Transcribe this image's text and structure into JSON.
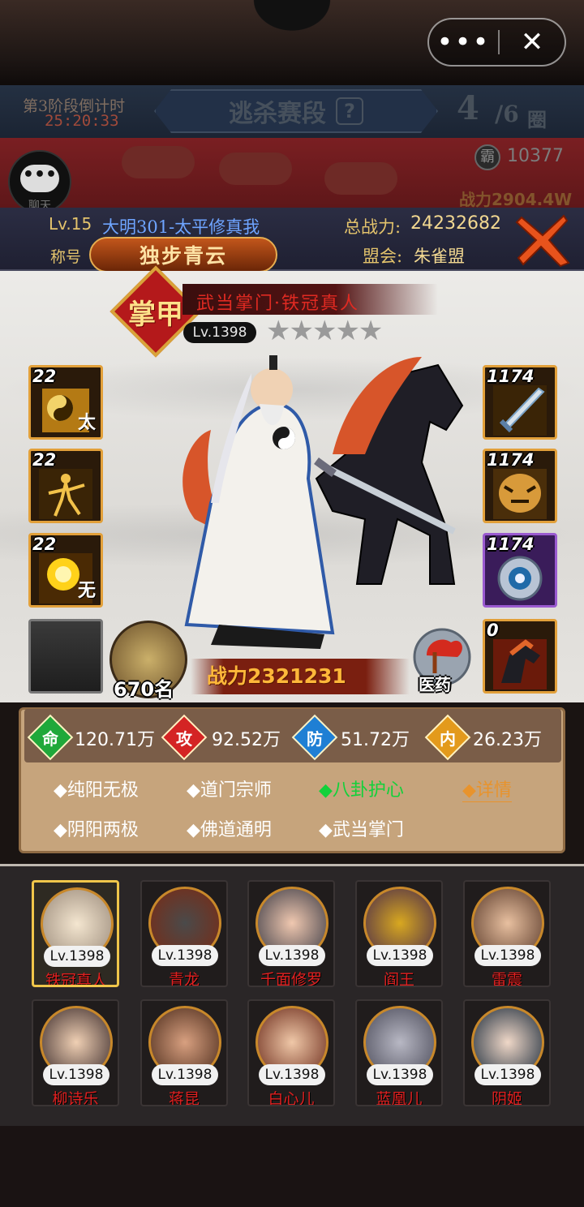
{
  "nav": {
    "more": "•••",
    "close": "✕"
  },
  "stage": {
    "countdown_label": "第3阶段倒计时",
    "countdown_time": "25:20:33",
    "title": "逃杀赛段",
    "help": "?",
    "round_current": "4",
    "round_total": "/6",
    "round_unit": "圈"
  },
  "bar": {
    "chat_label": "聊天",
    "chat_icon": "chat-bubble-icon",
    "coin_icon": "霸",
    "coin_value": "10377",
    "power": "战力2904.4W"
  },
  "player": {
    "level": "Lv.15",
    "server": "大明301-太平修真我",
    "title_label": "称号",
    "title_badge": "独步青云",
    "total_power_label": "总战力:",
    "total_power": "24232682",
    "guild_label": "盟会:",
    "guild": "朱雀盟"
  },
  "hero": {
    "rank_emblem": "掌甲",
    "name": "武当掌门·铁冠真人",
    "level": "Lv.1398",
    "stars": "★★★★★",
    "rank": "670名",
    "power": "战力2321231",
    "medicine_label": "医药",
    "left_slots": [
      {
        "num": "22",
        "tag": "太"
      },
      {
        "num": "22",
        "tag": ""
      },
      {
        "num": "22",
        "tag": "无"
      },
      {
        "num": "",
        "tag": ""
      }
    ],
    "right_slots": [
      {
        "num": "1174",
        "icon": "sword-icon"
      },
      {
        "num": "1174",
        "icon": "tiger-armor-icon"
      },
      {
        "num": "1174",
        "icon": "bagua-talisman-icon"
      },
      {
        "num": "0",
        "icon": "horse-icon"
      }
    ]
  },
  "stats": [
    {
      "label": "命",
      "value": "120.71万",
      "color": "#1fa83a"
    },
    {
      "label": "攻",
      "value": "92.52万",
      "color": "#d42424"
    },
    {
      "label": "防",
      "value": "51.72万",
      "color": "#1f7fd4"
    },
    {
      "label": "内",
      "value": "26.23万",
      "color": "#e39a1c"
    }
  ],
  "skills": {
    "row1": [
      "◆纯阳无极",
      "◆道门宗师",
      "◆八卦护心"
    ],
    "details": "◆详情",
    "row2": [
      "◆阴阳两极",
      "◆佛道通明",
      "◆武当掌门"
    ]
  },
  "roster": [
    {
      "level": "Lv.1398",
      "name": "铁冠真人"
    },
    {
      "level": "Lv.1398",
      "name": "青龙"
    },
    {
      "level": "Lv.1398",
      "name": "千面修罗"
    },
    {
      "level": "Lv.1398",
      "name": "阎王"
    },
    {
      "level": "Lv.1398",
      "name": "雷震"
    },
    {
      "level": "Lv.1398",
      "name": "柳诗乐"
    },
    {
      "level": "Lv.1398",
      "name": "蒋昆"
    },
    {
      "level": "Lv.1398",
      "name": "白心儿"
    },
    {
      "level": "Lv.1398",
      "name": "蓝凰儿"
    },
    {
      "level": "Lv.1398",
      "name": "阴姬"
    }
  ]
}
